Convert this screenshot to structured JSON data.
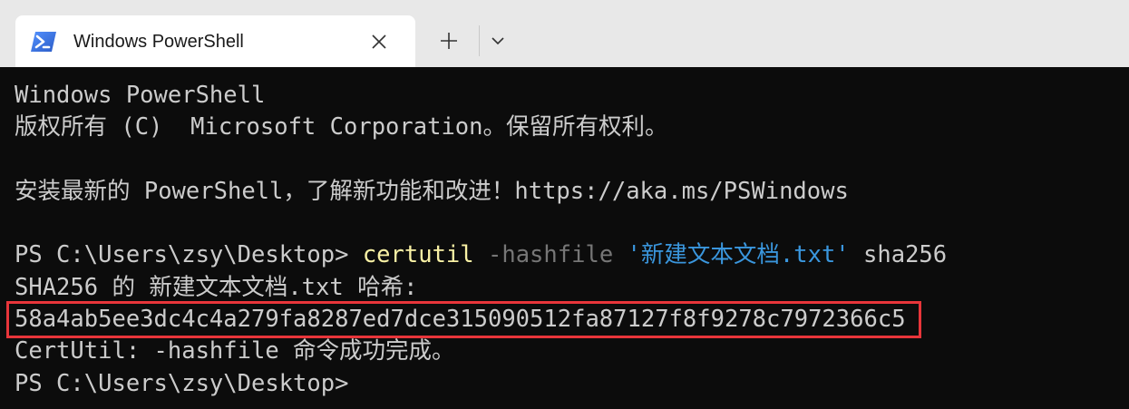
{
  "window": {
    "tab_title": "Windows PowerShell",
    "icons": {
      "tab": "powershell-icon",
      "close": "close-icon",
      "new_tab": "plus-icon",
      "dropdown": "chevron-down-icon"
    }
  },
  "terminal": {
    "banner_1": "Windows PowerShell",
    "banner_2": "版权所有 (C)  Microsoft Corporation。保留所有权利。",
    "install_msg": "安装最新的 PowerShell，了解新功能和改进！https://aka.ms/PSWindows",
    "prompt": "PS C:\\Users\\zsy\\Desktop> ",
    "command": {
      "name": "certutil",
      "param": "-hashfile",
      "arg": "'新建文本文档.txt'",
      "algo": "sha256"
    },
    "hash_header": "SHA256 的 新建文本文档.txt 哈希:",
    "hash_value": "58a4ab5ee3dc4c4a279fa8287ed7dce315090512fa87127f8f9278c7972366c5",
    "success_msg": "CertUtil: -hashfile 命令成功完成。",
    "final_prompt": "PS C:\\Users\\zsy\\Desktop>"
  },
  "colors": {
    "background": "#0c0c0c",
    "foreground": "#cccccc",
    "command": "#f9f1a5",
    "parameter": "#767676",
    "string": "#3a96dd",
    "highlight_box": "#e8353a"
  }
}
